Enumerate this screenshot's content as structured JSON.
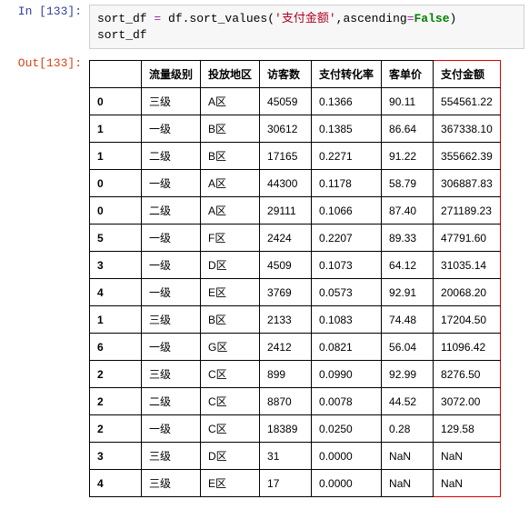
{
  "input": {
    "prompt": "In [133]:",
    "code_parts": {
      "var1": "sort_df",
      "eq": " = ",
      "call": "df.sort_values",
      "lp": "(",
      "str": "'支付金额'",
      "comma": ",",
      "arg": "ascending",
      "eq2": "=",
      "val": "False",
      "rp": ")",
      "line2": "sort_df"
    }
  },
  "output": {
    "prompt": "Out[133]:",
    "columns": [
      "流量级别",
      "投放地区",
      "访客数",
      "支付转化率",
      "客单价",
      "支付金额"
    ],
    "rows": [
      {
        "idx": "0",
        "c": [
          "三级",
          "A区",
          "45059",
          "0.1366",
          "90.11",
          "554561.22"
        ]
      },
      {
        "idx": "1",
        "c": [
          "一级",
          "B区",
          "30612",
          "0.1385",
          "86.64",
          "367338.10"
        ]
      },
      {
        "idx": "1",
        "c": [
          "二级",
          "B区",
          "17165",
          "0.2271",
          "91.22",
          "355662.39"
        ]
      },
      {
        "idx": "0",
        "c": [
          "一级",
          "A区",
          "44300",
          "0.1178",
          "58.79",
          "306887.83"
        ]
      },
      {
        "idx": "0",
        "c": [
          "二级",
          "A区",
          "29111",
          "0.1066",
          "87.40",
          "271189.23"
        ]
      },
      {
        "idx": "5",
        "c": [
          "一级",
          "F区",
          "2424",
          "0.2207",
          "89.33",
          "47791.60"
        ]
      },
      {
        "idx": "3",
        "c": [
          "一级",
          "D区",
          "4509",
          "0.1073",
          "64.12",
          "31035.14"
        ]
      },
      {
        "idx": "4",
        "c": [
          "一级",
          "E区",
          "3769",
          "0.0573",
          "92.91",
          "20068.20"
        ]
      },
      {
        "idx": "1",
        "c": [
          "三级",
          "B区",
          "2133",
          "0.1083",
          "74.48",
          "17204.50"
        ]
      },
      {
        "idx": "6",
        "c": [
          "一级",
          "G区",
          "2412",
          "0.0821",
          "56.04",
          "11096.42"
        ]
      },
      {
        "idx": "2",
        "c": [
          "三级",
          "C区",
          "899",
          "0.0990",
          "92.99",
          "8276.50"
        ]
      },
      {
        "idx": "2",
        "c": [
          "二级",
          "C区",
          "8870",
          "0.0078",
          "44.52",
          "3072.00"
        ]
      },
      {
        "idx": "2",
        "c": [
          "一级",
          "C区",
          "18389",
          "0.0250",
          "0.28",
          "129.58"
        ]
      },
      {
        "idx": "3",
        "c": [
          "三级",
          "D区",
          "31",
          "0.0000",
          "NaN",
          "NaN"
        ]
      },
      {
        "idx": "4",
        "c": [
          "三级",
          "E区",
          "17",
          "0.0000",
          "NaN",
          "NaN"
        ]
      }
    ]
  }
}
